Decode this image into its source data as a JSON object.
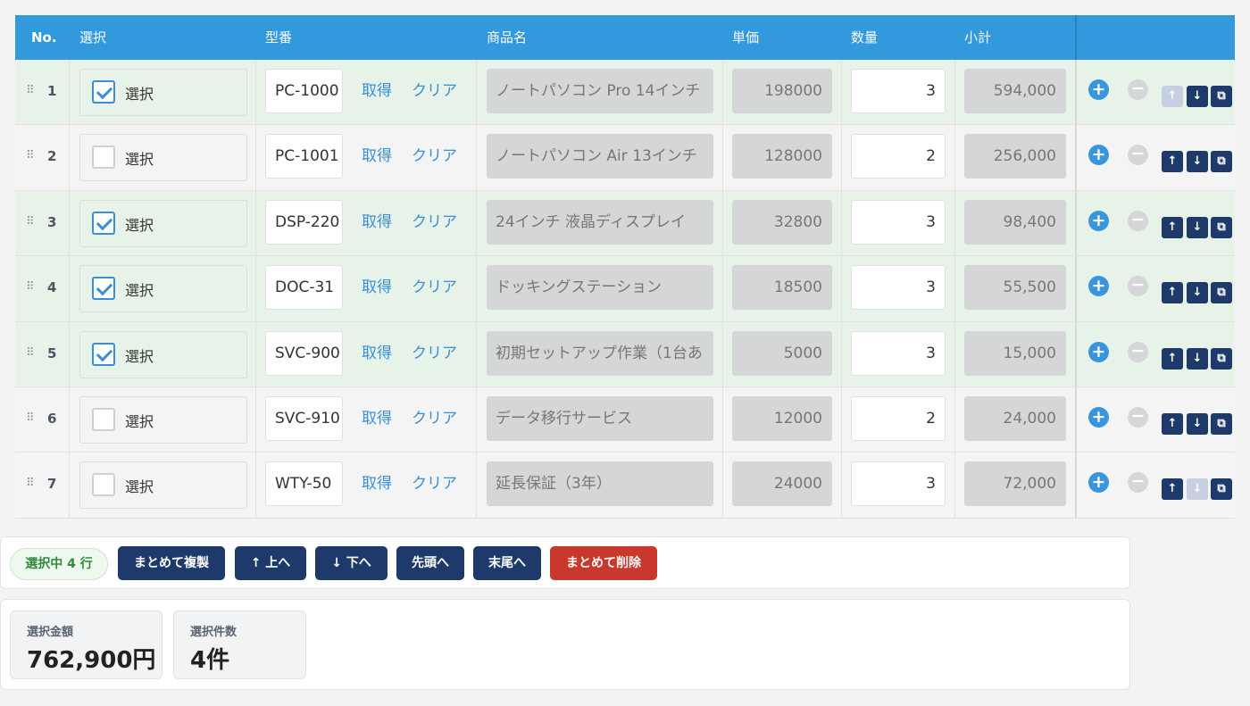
{
  "header": {
    "no": "No.",
    "select": "選択",
    "sku": "型番",
    "name": "商品名",
    "price": "単価",
    "qty": "数量",
    "subtotal": "小計"
  },
  "labels": {
    "select": "選択",
    "fetch": "取得",
    "clear": "クリア"
  },
  "rows": [
    {
      "no": "1",
      "checked": true,
      "sku": "PC-1000",
      "name": "ノートパソコン Pro 14インチ",
      "price": "198000",
      "qty": "3",
      "subtotal": "594,000",
      "up_disabled": true,
      "down_disabled": false
    },
    {
      "no": "2",
      "checked": false,
      "sku": "PC-1001",
      "name": "ノートパソコン Air 13インチ",
      "price": "128000",
      "qty": "2",
      "subtotal": "256,000",
      "up_disabled": false,
      "down_disabled": false
    },
    {
      "no": "3",
      "checked": true,
      "sku": "DSP-220",
      "name": "24インチ 液晶ディスプレイ",
      "price": "32800",
      "qty": "3",
      "subtotal": "98,400",
      "up_disabled": false,
      "down_disabled": false
    },
    {
      "no": "4",
      "checked": true,
      "sku": "DOC-31",
      "name": "ドッキングステーション",
      "price": "18500",
      "qty": "3",
      "subtotal": "55,500",
      "up_disabled": false,
      "down_disabled": false
    },
    {
      "no": "5",
      "checked": true,
      "sku": "SVC-900",
      "name": "初期セットアップ作業（1台あ",
      "price": "5000",
      "qty": "3",
      "subtotal": "15,000",
      "up_disabled": false,
      "down_disabled": false
    },
    {
      "no": "6",
      "checked": false,
      "sku": "SVC-910",
      "name": "データ移行サービス",
      "price": "12000",
      "qty": "2",
      "subtotal": "24,000",
      "up_disabled": false,
      "down_disabled": false
    },
    {
      "no": "7",
      "checked": false,
      "sku": "WTY-50",
      "name": "延長保証（3年）",
      "price": "24000",
      "qty": "3",
      "subtotal": "72,000",
      "up_disabled": false,
      "down_disabled": true
    }
  ],
  "icons": {
    "grip": "⠿",
    "plus": "+",
    "minus": "−",
    "up": "↑",
    "down": "↓",
    "duplicate": "⧉"
  },
  "toolbar": {
    "selected_count": "選択中 4 行",
    "bulk_copy": "まとめて複製",
    "move_up": "↑ 上へ",
    "move_down": "↓ 下へ",
    "to_top": "先頭へ",
    "to_bottom": "末尾へ",
    "bulk_delete": "まとめて削除"
  },
  "summary": {
    "amount_label": "選択金額",
    "amount_value": "762,900円",
    "count_label": "選択件数",
    "count_value": "4件"
  },
  "colors": {
    "header": "#3399dd",
    "selected_row": "#e7f3e8",
    "primary_button": "#1d3a6b",
    "danger_button": "#c8382c",
    "link": "#3a8fd6"
  }
}
